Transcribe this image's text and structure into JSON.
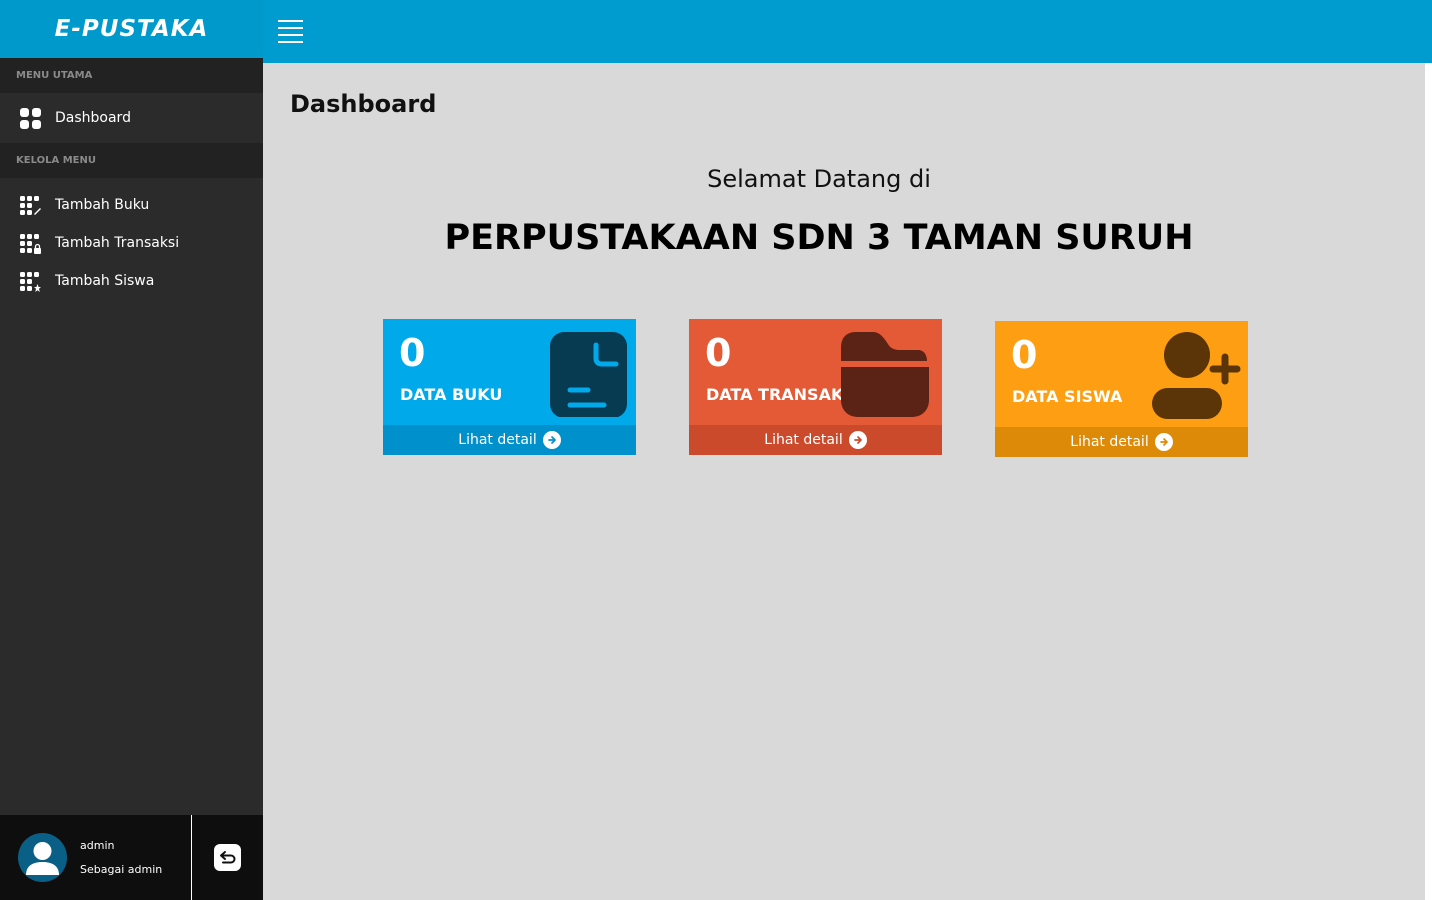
{
  "brand": {
    "title": "E-PUSTAKA"
  },
  "sidebar": {
    "section_main": "MENU UTAMA",
    "dashboard_label": "Dashboard",
    "section_manage": "KELOLA MENU",
    "items": [
      {
        "label": "Tambah Buku",
        "icon": "grid-edit-icon"
      },
      {
        "label": "Tambah Transaksi",
        "icon": "grid-lock-icon"
      },
      {
        "label": "Tambah Siswa",
        "icon": "grid-star-icon"
      }
    ]
  },
  "user": {
    "name": "admin",
    "role": "Sebagai admin"
  },
  "main": {
    "page_title": "Dashboard",
    "welcome": "Selamat Datang di",
    "school": "PERPUSTAKAAN SDN 3 TAMAN SURUH"
  },
  "cards": [
    {
      "count": "0",
      "label": "DATA BUKU",
      "footer": "Lihat detail",
      "color": "#00a9ea",
      "icon": "document-icon"
    },
    {
      "count": "0",
      "label": "DATA TRANSAKSI",
      "footer": "Lihat detail",
      "color": "#e55a36",
      "icon": "folder-icon"
    },
    {
      "count": "0",
      "label": "DATA SISWA",
      "footer": "Lihat detail",
      "color": "#fd9e13",
      "icon": "user-plus-icon"
    }
  ],
  "colors": {
    "topbar": "#009ccf",
    "sidebar": "#2b2b2b",
    "content_bg": "#d9d9d9"
  }
}
